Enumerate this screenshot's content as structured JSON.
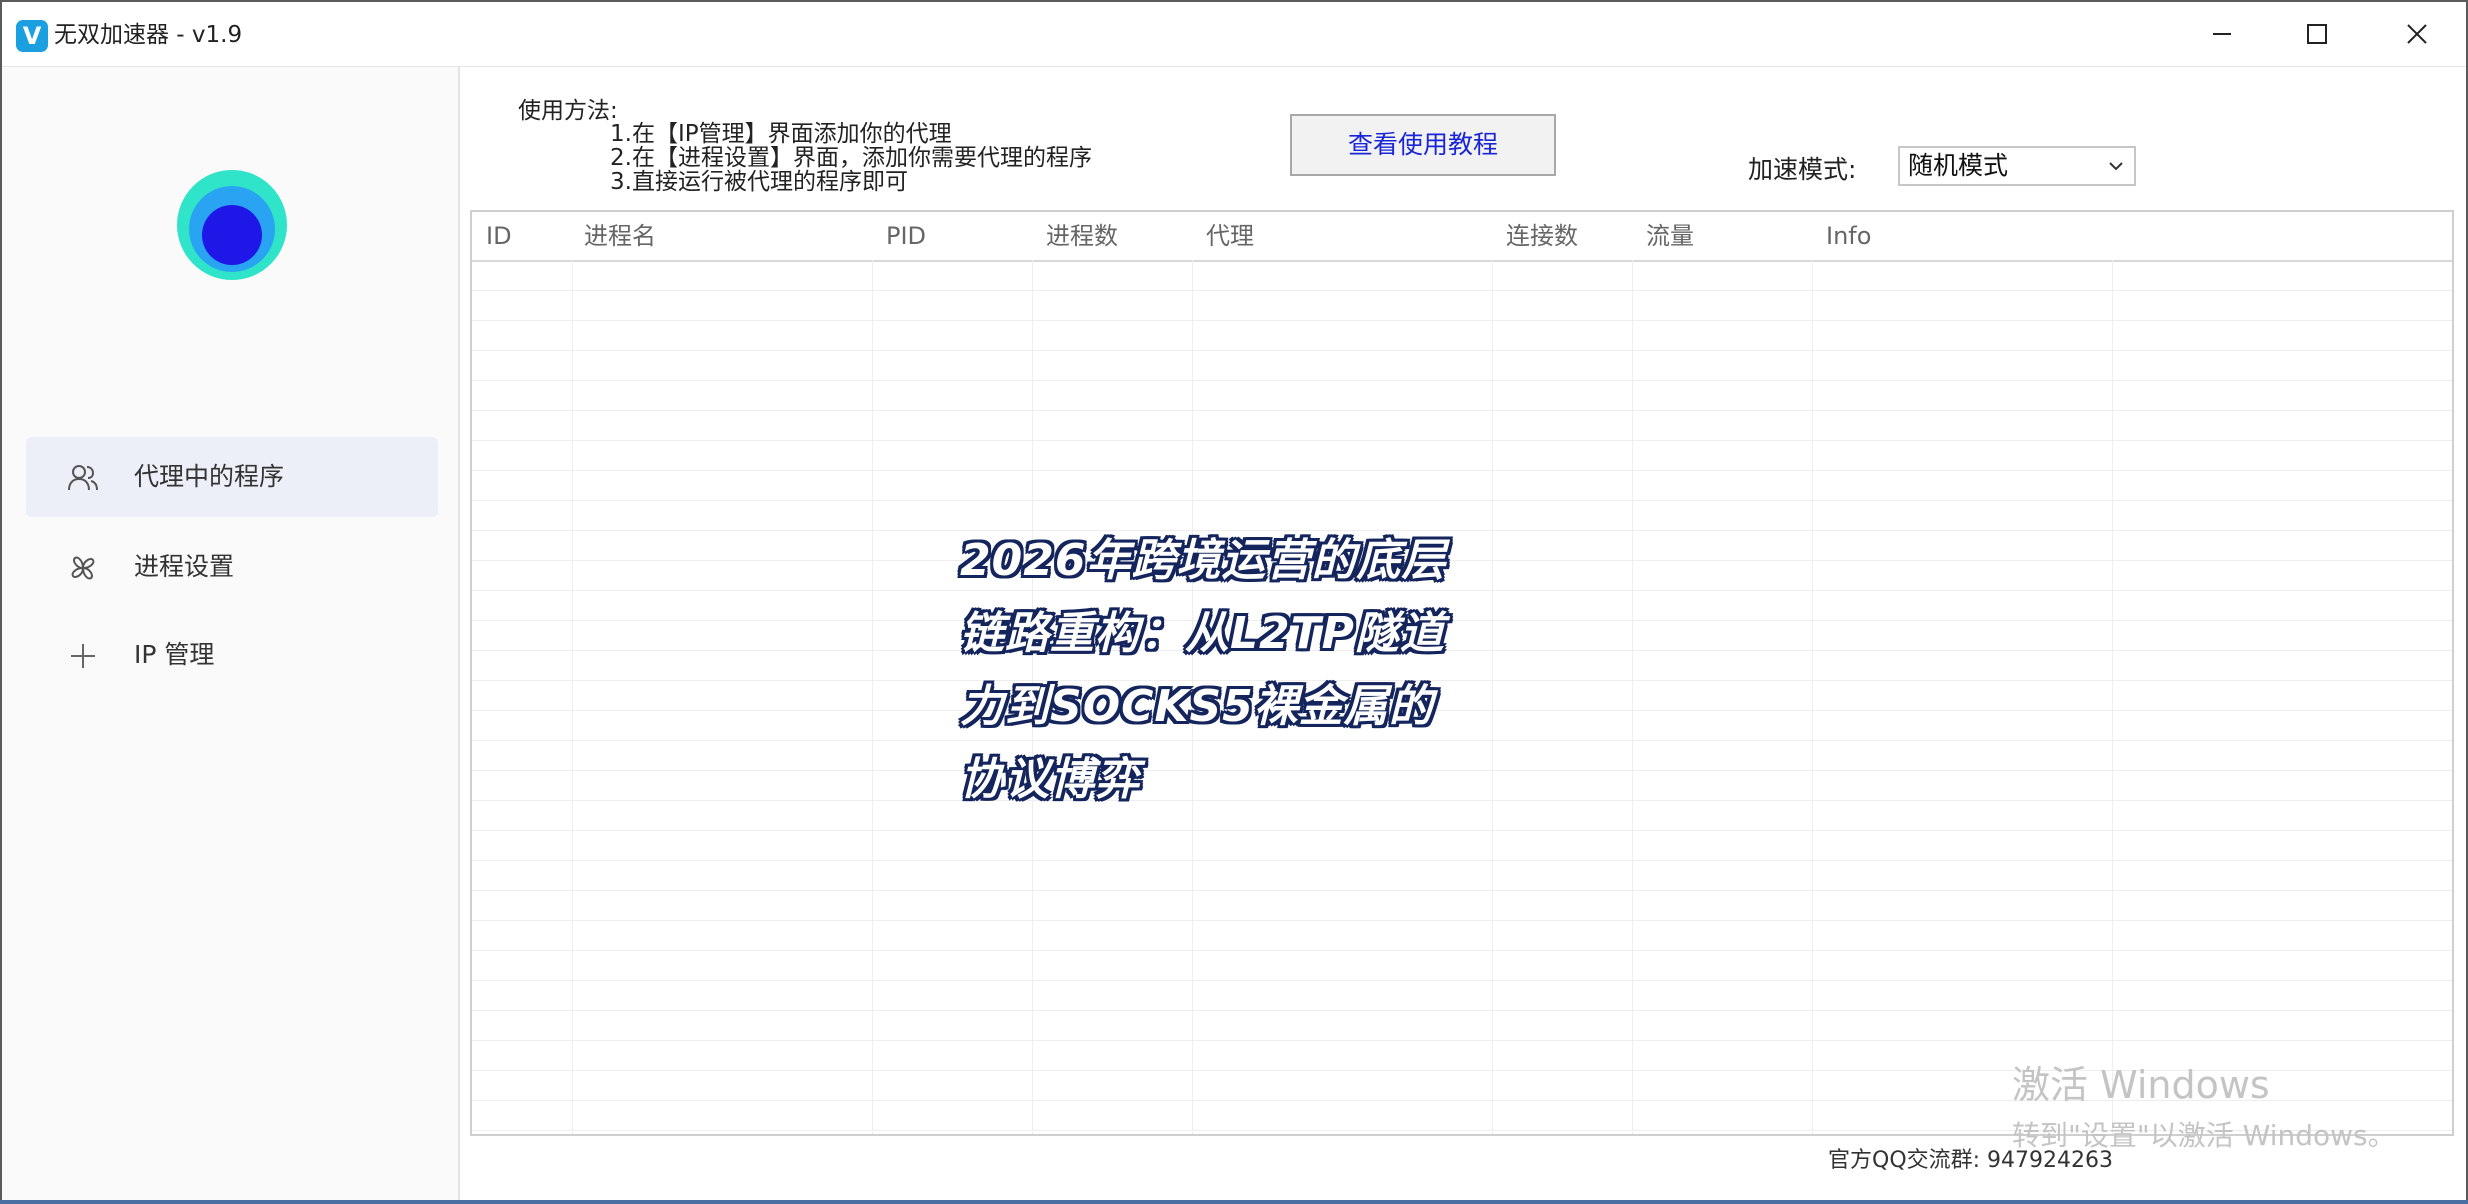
{
  "window": {
    "title": "无双加速器 - v1.9",
    "logo_letter": "V"
  },
  "sidebar": {
    "items": [
      {
        "label": "代理中的程序",
        "icon": "users-icon",
        "active": true
      },
      {
        "label": "进程设置",
        "icon": "settings-flower-icon",
        "active": false
      },
      {
        "label": "IP 管理",
        "icon": "plus-icon",
        "active": false
      }
    ]
  },
  "usage": {
    "title": "使用方法:",
    "steps": [
      "1.在【IP管理】界面添加你的代理",
      "2.在【进程设置】界面，添加你需要代理的程序",
      "3.直接运行被代理的程序即可"
    ]
  },
  "tutorial_button": {
    "label": "查看使用教程"
  },
  "mode": {
    "label": "加速模式:",
    "value": "随机模式"
  },
  "table": {
    "columns": [
      "ID",
      "进程名",
      "PID",
      "进程数",
      "代理",
      "连接数",
      "流量",
      "Info"
    ],
    "rows": []
  },
  "overlay": {
    "lines": [
      "2026年跨境运营的底层",
      "链路重构：从L2TP隧道",
      "力到SOCKS5裸金属的",
      "协议博弈"
    ]
  },
  "watermark": {
    "line1": "激活 Windows",
    "line2": "转到\"设置\"以激活 Windows。"
  },
  "footer": {
    "qq_group": "官方QQ交流群: 947924263"
  },
  "colors": {
    "accent_blue": "#1a25d6",
    "logo_blue": "#1a9fe0",
    "sidebar_active": "#eceff7",
    "overlay_outline": "#14245c"
  }
}
